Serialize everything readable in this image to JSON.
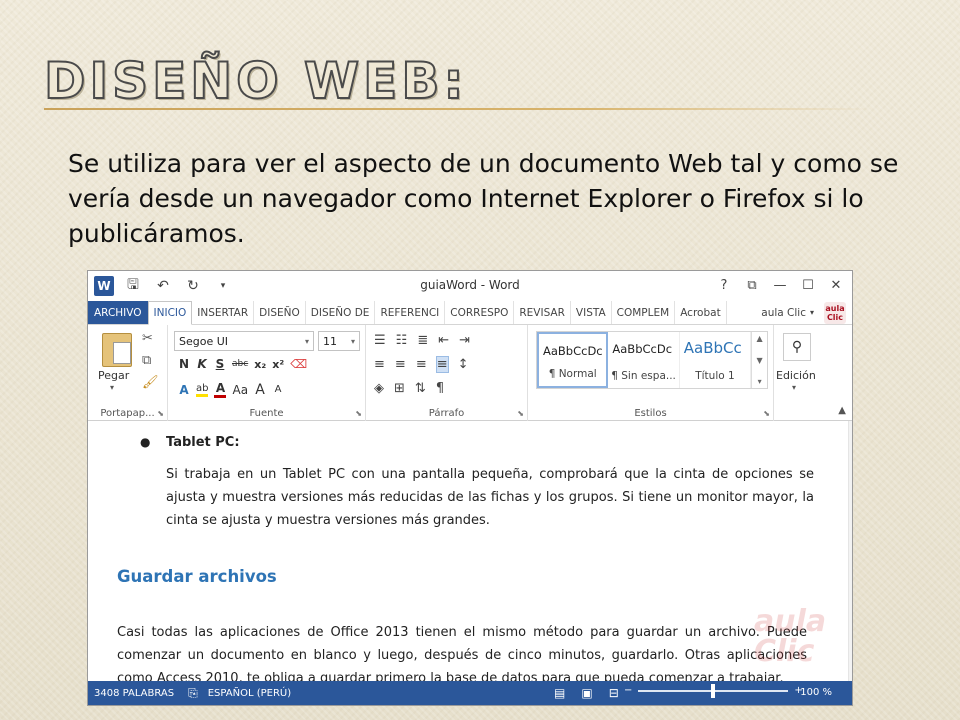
{
  "slide": {
    "title": "Diseño web:",
    "body": "Se utiliza para ver el aspecto de un documento Web tal y como se vería desde un navegador como Internet Explorer o Firefox si lo publicáramos."
  },
  "word": {
    "app_icon": "W",
    "window_title": "guiaWord - Word",
    "qat": {
      "save_icon": "floppy-icon",
      "undo_icon": "undo-icon",
      "redo_icon": "redo-icon",
      "customize_icon": "customize-icon"
    },
    "window_controls": {
      "help": "?",
      "ribbon_display": "⧉",
      "minimize": "—",
      "maximize": "☐",
      "close": "✕"
    },
    "tabs": [
      "ARCHIVO",
      "INICIO",
      "INSERTAR",
      "DISEÑO",
      "DISEÑO DE",
      "REFERENCI",
      "CORRESPO",
      "REVISAR",
      "VISTA",
      "COMPLEM",
      "Acrobat"
    ],
    "active_tab": "INICIO",
    "user": "aula Clic",
    "user_logo_text": "aula Clic",
    "ribbon": {
      "clipboard": {
        "label": "Portapap...",
        "paste_label": "Pegar"
      },
      "font": {
        "label": "Fuente",
        "font_name": "Segoe UI",
        "font_size": "11",
        "row1": [
          "N",
          "K",
          "S",
          "abc",
          "x₂",
          "x²"
        ],
        "row2": [
          "A",
          "ab",
          "A",
          "Aa",
          "A",
          "A"
        ]
      },
      "paragraph": {
        "label": "Párrafo",
        "pilcrow": "¶"
      },
      "styles": {
        "label": "Estilos",
        "items": [
          {
            "sample": "AaBbCcDc",
            "name": "¶ Normal"
          },
          {
            "sample": "AaBbCcDc",
            "name": "¶ Sin espa..."
          },
          {
            "sample": "AaBbCc",
            "name": "Título 1"
          }
        ]
      },
      "editing": {
        "label": "Edición"
      }
    },
    "document": {
      "bullet_title": "Tablet PC:",
      "bullet_text": "Si trabaja en un Tablet PC con una pantalla pequeña, comprobará que la cinta de opciones se ajusta y muestra versiones más reducidas de las fichas y los grupos. Si tiene un monitor mayor, la cinta se ajusta y muestra versiones más grandes.",
      "heading": "Guardar archivos",
      "paragraph": "Casi todas las aplicaciones de Office 2013 tienen el mismo método para guardar un archivo. Puede comenzar un documento en blanco y luego, después de cinco minutos, guardarlo. Otras aplicaciones como Access 2010, te obliga a guardar primero la base de datos para que pueda comenzar a trabajar.",
      "watermark": "aula Clic"
    },
    "status": {
      "words": "3408 PALABRAS",
      "language": "ESPAÑOL (PERÚ)",
      "zoom": "100 %",
      "zoom_level_fraction": 0.5
    }
  }
}
